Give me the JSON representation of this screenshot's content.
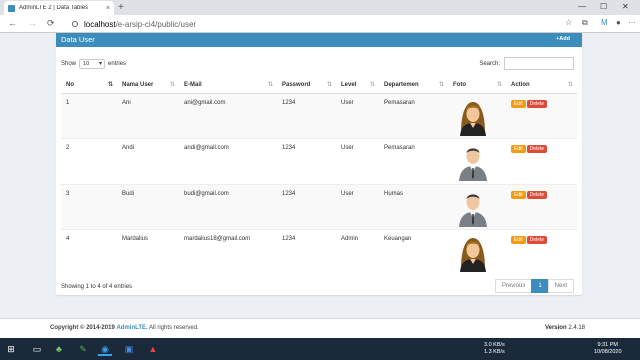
{
  "browser": {
    "tab_title": "AdminLTE 2 | Data Tables",
    "tab_close": "×",
    "new_tab": "+",
    "url_host": "localhost",
    "url_path": "/e-arsip-ci4/public/user",
    "back": "←",
    "forward": "→",
    "reload": "⟳",
    "minimize": "—",
    "maximize": "☐",
    "close": "✕",
    "star": "☆",
    "collections": "⧉",
    "profile": "●",
    "more": "···",
    "ext_badge": "M"
  },
  "box": {
    "title": "Data User",
    "add_label": "+Add",
    "show_label": "Show",
    "show_value": "10",
    "entries_label": "entries",
    "search_label": "Search:",
    "search_value": ""
  },
  "table": {
    "headers": [
      "No",
      "Nama User",
      "E-Mail",
      "Password",
      "Level",
      "Departemen",
      "Foto",
      "Action"
    ],
    "rows": [
      {
        "no": "1",
        "nama": "Ani",
        "email": "ani@gmail.com",
        "password": "1234",
        "level": "User",
        "dept": "Pemasaran",
        "foto": "female"
      },
      {
        "no": "2",
        "nama": "Andi",
        "email": "andi@gmail.com",
        "password": "1234",
        "level": "User",
        "dept": "Pemasaran",
        "foto": "male"
      },
      {
        "no": "3",
        "nama": "Budi",
        "email": "budi@gmail.com",
        "password": "1234",
        "level": "User",
        "dept": "Humas",
        "foto": "male"
      },
      {
        "no": "4",
        "nama": "Mardalius",
        "email": "mardalius18@gmail.com",
        "password": "1234",
        "level": "Admin",
        "dept": "Keuangan",
        "foto": "female"
      }
    ],
    "edit_label": "Edit",
    "delete_label": "Delete"
  },
  "footer_table": {
    "info": "Showing 1 to 4 of 4 entries",
    "prev": "Previous",
    "page": "1",
    "next": "Next"
  },
  "footer": {
    "copyright": "Copyright © 2014-2019",
    "brand": "AdminLTE.",
    "rights": "All rights reserved.",
    "version_label": "Version",
    "version_value": "2.4.18"
  },
  "taskbar": {
    "net_up": "3.0 KB/s",
    "net_down": "1.3 KB/s",
    "time": "9:31 PM",
    "date": "10/08/2020"
  },
  "colors": {
    "primary": "#3c8dbc",
    "edit": "#f39c12",
    "delete": "#dd4b39"
  }
}
